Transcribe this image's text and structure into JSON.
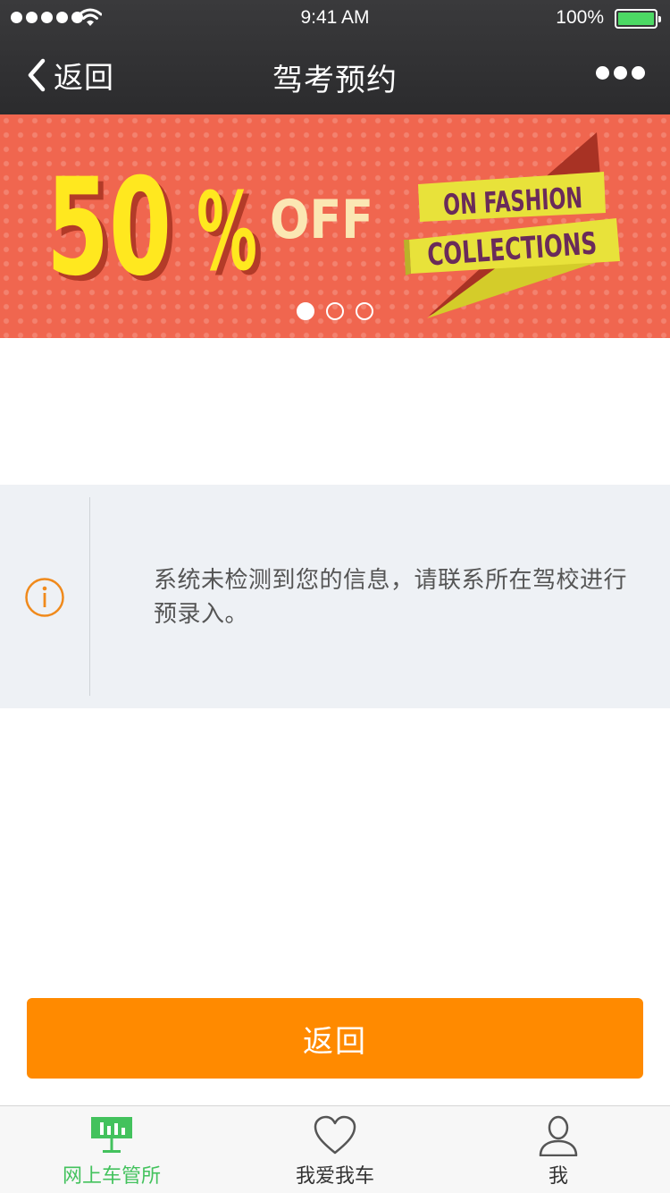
{
  "status_bar": {
    "time": "9:41 AM",
    "battery": "100%",
    "signal_bars": 5
  },
  "nav": {
    "back_label": "返回",
    "title": "驾考预约"
  },
  "banner": {
    "big_number": "50",
    "percent": "%",
    "off": "OFF",
    "ribbon_line1": "ON FASHION",
    "ribbon_line2": "COLLECTIONS",
    "page_count": 3,
    "active_page": 1
  },
  "notice": {
    "text": "系统未检测到您的信息，请联系所在驾校进行预录入。"
  },
  "action": {
    "return_label": "返回"
  },
  "tabbar": {
    "items": [
      {
        "label": "网上车管所",
        "icon": "station-icon",
        "active": true
      },
      {
        "label": "我爱我车",
        "icon": "heart-icon",
        "active": false
      },
      {
        "label": "我",
        "icon": "user-icon",
        "active": false
      }
    ]
  },
  "colors": {
    "accent": "#ff8a00",
    "tab_active": "#43c25d",
    "banner_bg": "#f0664f",
    "nav_bg": "#333335"
  }
}
